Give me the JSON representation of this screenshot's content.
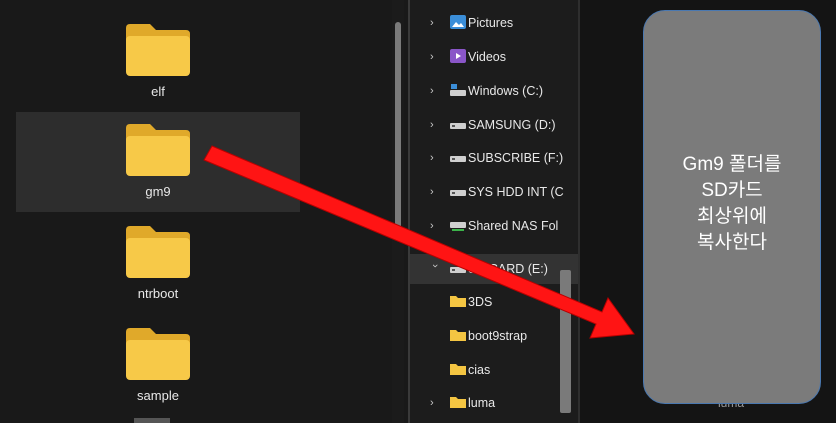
{
  "left_pane": {
    "folders": [
      {
        "label": "elf"
      },
      {
        "label": "gm9"
      },
      {
        "label": "ntrboot"
      },
      {
        "label": "sample"
      }
    ]
  },
  "nav_pane": {
    "items": [
      {
        "label": "Pictures",
        "icon": "pictures-icon"
      },
      {
        "label": "Videos",
        "icon": "videos-icon"
      },
      {
        "label": "Windows (C:)",
        "icon": "drive-windows-icon"
      },
      {
        "label": "SAMSUNG (D:)",
        "icon": "drive-icon"
      },
      {
        "label": "SUBSCRIBE (F:)",
        "icon": "drive-icon"
      },
      {
        "label": "SYS HDD INT (C",
        "icon": "drive-icon"
      },
      {
        "label": "Shared NAS Fol",
        "icon": "network-drive-icon"
      },
      {
        "label": "SD CARD (E:)",
        "icon": "sd-card-drive-icon"
      },
      {
        "label": "3DS",
        "icon": "folder-icon"
      },
      {
        "label": "boot9strap",
        "icon": "folder-icon"
      },
      {
        "label": "cias",
        "icon": "folder-icon"
      },
      {
        "label": "luma",
        "icon": "folder-icon"
      }
    ]
  },
  "hint": {
    "line1": "Gm9 폴더를",
    "line2": "SD카드",
    "line3": "최상위에",
    "line4": "복사한다"
  },
  "right_pane": {
    "partial_label": "luma"
  },
  "colors": {
    "arrow": "#ff1414",
    "folder_yellow": "#f4c542",
    "hint_box": "#7b7b7b"
  }
}
